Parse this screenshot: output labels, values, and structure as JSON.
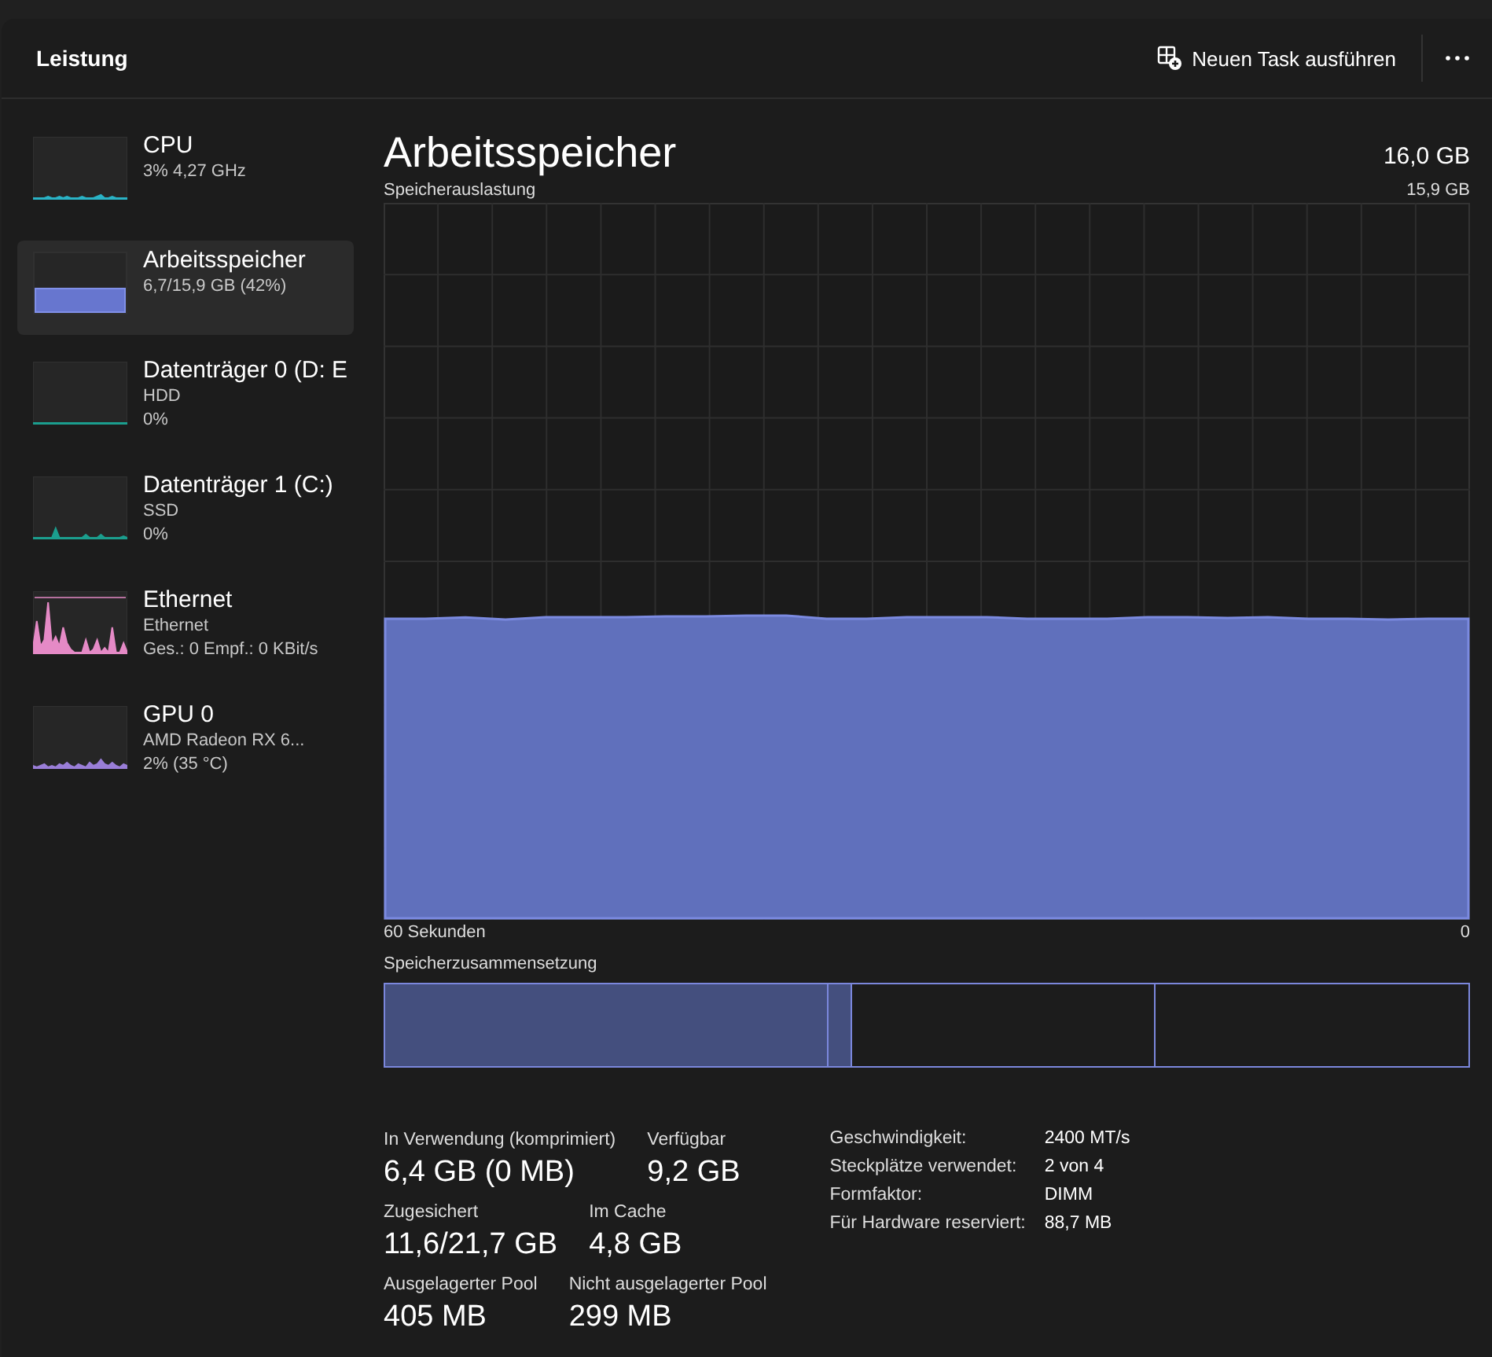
{
  "header": {
    "title": "Leistung",
    "run_task": "Neuen Task ausführen"
  },
  "sidebar": {
    "items": [
      {
        "name": "CPU",
        "lines": [
          "3%  4,27 GHz"
        ],
        "selected": false,
        "kind": "sparkline",
        "color": "#2ab3c6"
      },
      {
        "name": "Arbeitsspeicher",
        "lines": [
          "6,7/15,9 GB (42%)"
        ],
        "selected": true,
        "kind": "fill",
        "color": "#6776cf"
      },
      {
        "name": "Datenträger 0 (D: E",
        "lines": [
          "HDD",
          "0%"
        ],
        "selected": false,
        "kind": "flat",
        "color": "#1b9e8e"
      },
      {
        "name": "Datenträger 1 (C:)",
        "lines": [
          "SSD",
          "0%"
        ],
        "selected": false,
        "kind": "sparkline",
        "color": "#1b9e8e"
      },
      {
        "name": "Ethernet",
        "lines": [
          "Ethernet",
          "Ges.: 0 Empf.: 0 KBit/s"
        ],
        "selected": false,
        "kind": "sparkline",
        "color": "#e58ac6"
      },
      {
        "name": "GPU 0",
        "lines": [
          "AMD Radeon RX 6...",
          "2%  (35 °C)"
        ],
        "selected": false,
        "kind": "sparkline",
        "color": "#9a7ed8"
      }
    ]
  },
  "main": {
    "title": "Arbeitsspeicher",
    "total": "16,0 GB",
    "chart_label": "Speicherauslastung",
    "chart_max": "15,9 GB",
    "x_start": "60 Sekunden",
    "x_end": "0",
    "composition_label": "Speicherzusammensetzung",
    "composition": [
      {
        "filled": true
      },
      {
        "filled": true
      },
      {
        "filled": false
      },
      {
        "filled": false
      }
    ],
    "stats": [
      [
        {
          "label": "In Verwendung (komprimiert)",
          "value": "6,4 GB (0 MB)"
        },
        {
          "label": "Verfügbar",
          "value": "9,2 GB"
        }
      ],
      [
        {
          "label": "Zugesichert",
          "value": "11,6/21,7 GB"
        },
        {
          "label": "Im Cache",
          "value": "4,8 GB"
        }
      ],
      [
        {
          "label": "Ausgelagerter Pool",
          "value": "405 MB"
        },
        {
          "label": "Nicht ausgelagerter Pool",
          "value": "299 MB"
        }
      ]
    ],
    "details": [
      {
        "label": "Geschwindigkeit:",
        "value": "2400 MT/s"
      },
      {
        "label": "Steckplätze verwendet:",
        "value": "2 von 4"
      },
      {
        "label": "Formfaktor:",
        "value": "DIMM"
      },
      {
        "label": "Für Hardware reserviert:",
        "value": "88,7 MB"
      }
    ]
  }
}
